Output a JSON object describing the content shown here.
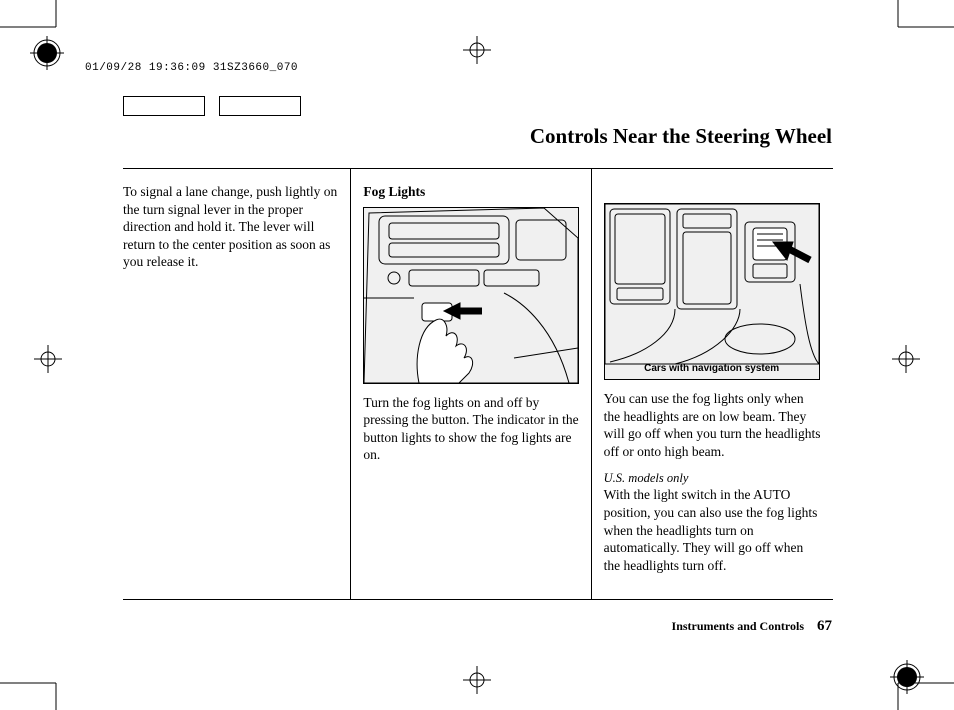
{
  "stamp": "01/09/28 19:36:09 31SZ3660_070",
  "page_title": "Controls Near the Steering Wheel",
  "columns": {
    "col1": {
      "p1": "To signal a lane change, push lightly on the turn signal lever in the proper direction and hold it. The lever will return to the center position as soon as you release it."
    },
    "col2": {
      "heading": "Fog Lights",
      "p1": "Turn the fog lights on and off by pressing the button. The indicator in the button lights to show the fog lights are on."
    },
    "col3": {
      "caption": "Cars with navigation system",
      "p1": "You can use the fog lights only when the headlights are on low beam. They will go off when you turn the headlights off or onto high beam.",
      "note": "U.S. models only",
      "p2": "With the light switch in the AUTO position, you can also use the fog lights when the headlights turn on automatically. They will go off when the headlights turn off."
    }
  },
  "footer": {
    "section": "Instruments and Controls",
    "page": "67"
  }
}
